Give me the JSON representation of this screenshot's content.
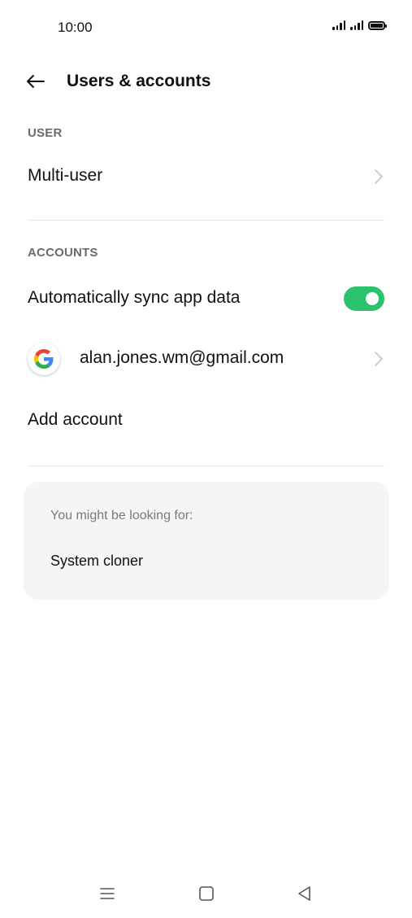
{
  "status_bar": {
    "time": "10:00",
    "icons": [
      "signal-icon",
      "signal-icon",
      "battery-icon"
    ]
  },
  "header": {
    "back_icon": "back-arrow-icon",
    "title": "Users & accounts"
  },
  "sections": {
    "user": {
      "label": "USER",
      "items": [
        {
          "label": "Multi-user",
          "icon": "chevron-right-icon"
        }
      ]
    },
    "accounts": {
      "label": "ACCOUNTS",
      "auto_sync": {
        "label": "Automatically sync app data",
        "enabled": true
      },
      "google_account": {
        "icon": "google-icon",
        "email": "alan.jones.wm@gmail.com"
      },
      "add_account_label": "Add account"
    }
  },
  "suggestions": {
    "title": "You might be looking for:",
    "items": [
      "System cloner"
    ]
  },
  "nav_bar": {
    "icons": [
      "menu-icon",
      "home-icon",
      "back-triangle-icon"
    ]
  },
  "colors": {
    "accent": "#2bc26b",
    "background": "#ffffff",
    "card_background": "#f5f5f5",
    "section_label": "#6b6b6b",
    "divider": "#e6e6e6"
  }
}
